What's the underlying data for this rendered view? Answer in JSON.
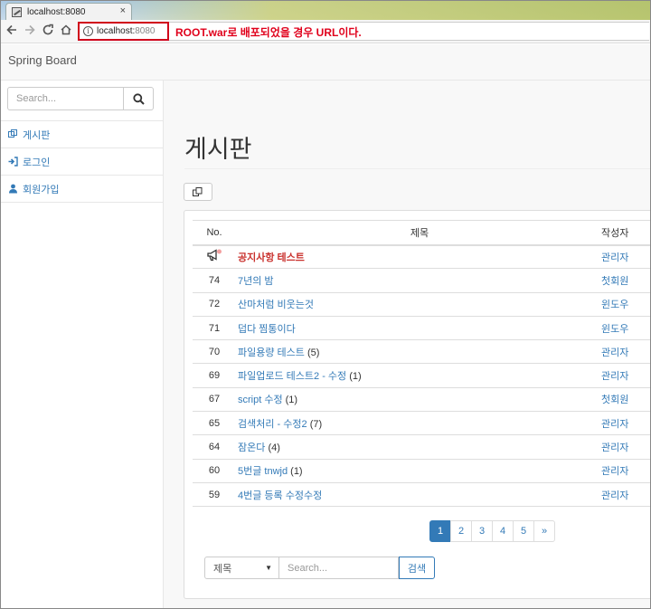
{
  "browser": {
    "tab_title": "localhost:8080",
    "tab_close": "×",
    "address_host": "localhost:",
    "address_port": "8080",
    "annotation": "ROOT.war로 배포되었을 경우 URL이다.",
    "info_glyph": "i"
  },
  "app": {
    "brand": "Spring Board"
  },
  "sidebar": {
    "search_placeholder": "Search...",
    "items": [
      {
        "label": "게시판",
        "icon": "board-icon"
      },
      {
        "label": "로그인",
        "icon": "sign-in-icon"
      },
      {
        "label": "회원가입",
        "icon": "user-icon"
      }
    ]
  },
  "main": {
    "title": "게시판",
    "table": {
      "headers": {
        "no": "No.",
        "title": "제목",
        "author": "작성자"
      },
      "rows": [
        {
          "no": "",
          "notice": true,
          "title": "공지사항 테스트",
          "count": "",
          "author": "관리자"
        },
        {
          "no": "74",
          "notice": false,
          "title": "7년의 밤",
          "count": "",
          "author": "첫회원"
        },
        {
          "no": "72",
          "notice": false,
          "title": "산마처럼 비웃는것",
          "count": "",
          "author": "윈도우"
        },
        {
          "no": "71",
          "notice": false,
          "title": "덥다 찜통이다",
          "count": "",
          "author": "윈도우"
        },
        {
          "no": "70",
          "notice": false,
          "title": "파일용량 테스트",
          "count": "(5)",
          "author": "관리자"
        },
        {
          "no": "69",
          "notice": false,
          "title": "파일업로드 테스트2 - 수정",
          "count": "(1)",
          "author": "관리자"
        },
        {
          "no": "67",
          "notice": false,
          "title": "script 수정",
          "count": "(1)",
          "author": "첫회원"
        },
        {
          "no": "65",
          "notice": false,
          "title": "검색처리 - 수정2",
          "count": "(7)",
          "author": "관리자"
        },
        {
          "no": "64",
          "notice": false,
          "title": "잠온다",
          "count": "(4)",
          "author": "관리자"
        },
        {
          "no": "60",
          "notice": false,
          "title": "5번글 tnwjd",
          "count": "(1)",
          "author": "관리자"
        },
        {
          "no": "59",
          "notice": false,
          "title": "4번글 등록 수정수정",
          "count": "",
          "author": "관리자"
        }
      ]
    },
    "pagination": [
      "1",
      "2",
      "3",
      "4",
      "5",
      "»"
    ],
    "active_page": "1",
    "search": {
      "select_value": "제목",
      "placeholder": "Search...",
      "button": "검색"
    }
  },
  "colors": {
    "link": "#337ab7",
    "notice": "#c9302c",
    "annotation": "#e0001b"
  }
}
